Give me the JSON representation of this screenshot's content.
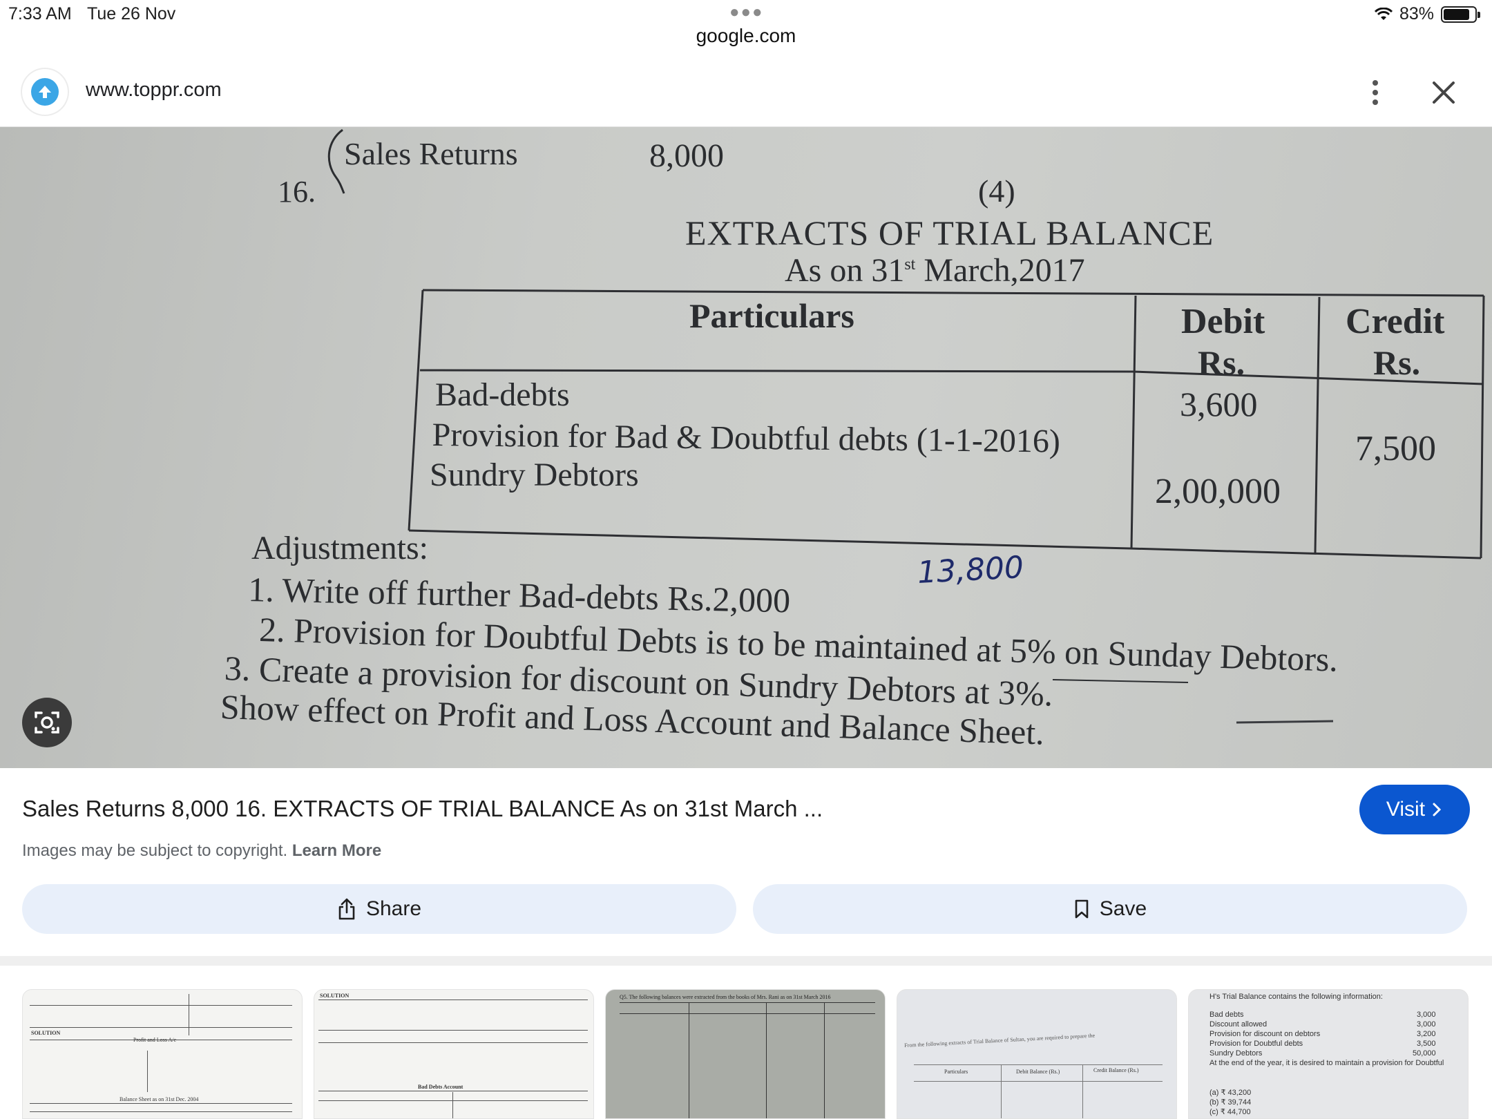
{
  "status_bar": {
    "time": "7:33 AM",
    "date": "Tue 26 Nov",
    "battery": "83%",
    "battery_level": 0.83,
    "url": "google.com"
  },
  "site_bar": {
    "url": "www.toppr.com"
  },
  "photo": {
    "line1_label": "Sales Returns",
    "line1_amount": "8,000",
    "question_no": "16.",
    "sub_no": "(4)",
    "heading": "EXTRACTS OF TRIAL BALANCE",
    "subheading_pre": "As on 31",
    "subheading_sup": "st",
    "subheading_post": " March,2017",
    "table": {
      "headers": [
        "Particulars",
        "Debit",
        "Rs.",
        "Credit",
        "Rs."
      ],
      "rows": [
        {
          "particular": "Bad-debts",
          "debit": "3,600",
          "credit": ""
        },
        {
          "particular": "Provision for Bad & Doubtful debts (1-1-2016)",
          "debit": "",
          "credit": "7,500"
        },
        {
          "particular": "Sundry Debtors",
          "debit": "2,00,000",
          "credit": ""
        }
      ]
    },
    "adjustments_title": "Adjustments:",
    "adjustments": [
      "1. Write off further Bad-debts Rs.2,000",
      "2. Provision for Doubtful Debts is to be maintained at 5% on Sunday Debtors.",
      "3. Create  a provision for discount on Sundry Debtors at 3%."
    ],
    "closing_line": "Show effect on Profit and Loss Account and Balance Sheet.",
    "handwritten_note": "13,800"
  },
  "result": {
    "title": "Sales Returns 8,000 16. EXTRACTS OF TRIAL BALANCE As on 31st March ...",
    "visit_label": "Visit",
    "copyright_text": "Images may be subject to copyright.",
    "learn_more": "Learn More",
    "share_label": "Share",
    "save_label": "Save"
  },
  "thumbnails": {
    "t1": {
      "solution": "SOLUTION",
      "pl": "Profit and Loss A/c",
      "bs": "Balance Sheet as on 31st Dec. 2004"
    },
    "t2": {
      "solution": "SOLUTION",
      "bad": "Bad Debts Account"
    },
    "t3": {
      "caption": "Q5. The following balances were extracted from the books of Mrs. Rani as on 31st March 2016"
    },
    "t4": {
      "caption": "From the following extracts of Trial Balance of Sultan, you are required to prepare the",
      "particulars": "Particulars",
      "debit": "Debit Balance (Rs.)",
      "credit": "Credit Balance (Rs.)"
    },
    "t5": {
      "heading": "H's Trial Balance contains the following information:",
      "rows": [
        {
          "label": "Bad debts",
          "value": "3,000"
        },
        {
          "label": "Discount allowed",
          "value": "3,000"
        },
        {
          "label": "Provision for discount on debtors",
          "value": "3,200"
        },
        {
          "label": "Provision for Doubtful debts",
          "value": "3,500"
        },
        {
          "label": "Sundry Debtors",
          "value": "50,000"
        }
      ],
      "note": "At the end of the year, it is desired to maintain a provision for Doubtful",
      "options": [
        "(a) ₹ 43,200",
        "(b) ₹ 39,744",
        "(c) ₹ 44,700"
      ]
    }
  }
}
